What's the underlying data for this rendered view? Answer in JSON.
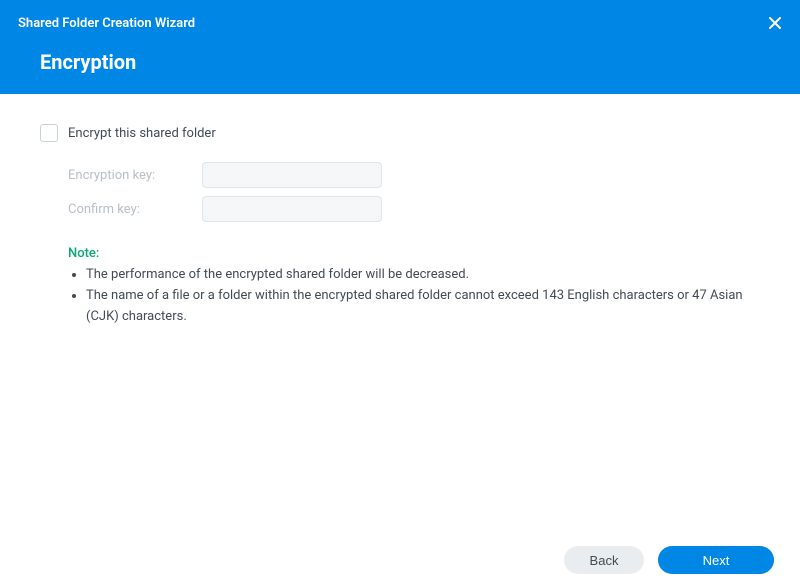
{
  "header": {
    "wizard_title": "Shared Folder Creation Wizard",
    "step_title": "Encryption"
  },
  "form": {
    "encrypt_checkbox_label": "Encrypt this shared folder",
    "encryption_key_label": "Encryption key:",
    "confirm_key_label": "Confirm key:",
    "encryption_key_value": "",
    "confirm_key_value": ""
  },
  "note": {
    "heading": "Note:",
    "items": [
      "The performance of the encrypted shared folder will be decreased.",
      "The name of a file or a folder within the encrypted shared folder cannot exceed 143 English characters or 47 Asian (CJK) characters."
    ]
  },
  "footer": {
    "back_label": "Back",
    "next_label": "Next"
  }
}
